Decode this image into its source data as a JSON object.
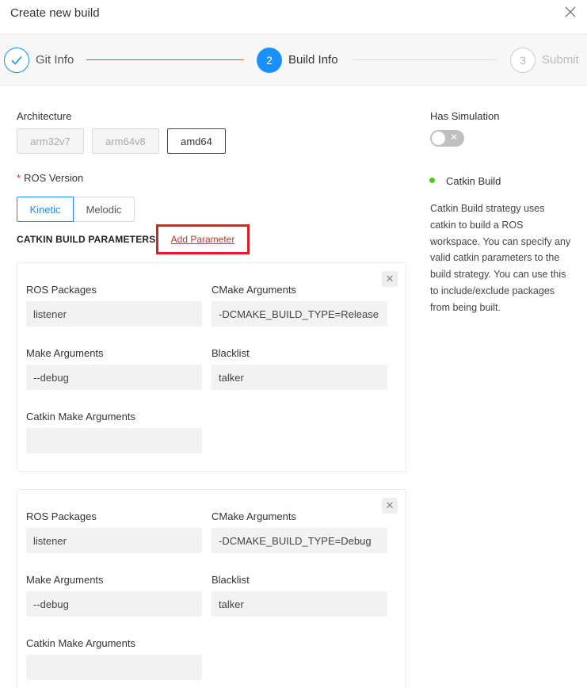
{
  "header": {
    "title": "Create new build"
  },
  "steps": [
    {
      "number": "",
      "label": "Git Info"
    },
    {
      "number": "2",
      "label": "Build Info"
    },
    {
      "number": "3",
      "label": "Submit"
    }
  ],
  "architecture": {
    "label": "Architecture",
    "options": [
      "arm32v7",
      "arm64v8",
      "amd64"
    ],
    "selected": "amd64"
  },
  "ros_version": {
    "required_mark": "*",
    "label": "ROS Version",
    "options": [
      "Kinetic",
      "Melodic"
    ],
    "selected": "Kinetic"
  },
  "catkin": {
    "section_title": "CATKIN BUILD PARAMETERS",
    "add_parameter": "Add Parameter",
    "field_labels": {
      "ros_packages": "ROS Packages",
      "cmake_arguments": "CMake Arguments",
      "make_arguments": "Make Arguments",
      "blacklist": "Blacklist",
      "catkin_make_arguments": "Catkin Make Arguments"
    },
    "parameters": [
      {
        "ros_packages": "listener",
        "cmake_arguments": "-DCMAKE_BUILD_TYPE=Release",
        "make_arguments": "--debug",
        "blacklist": "talker",
        "catkin_make_arguments": ""
      },
      {
        "ros_packages": "listener",
        "cmake_arguments": "-DCMAKE_BUILD_TYPE=Debug",
        "make_arguments": "--debug",
        "blacklist": "talker",
        "catkin_make_arguments": ""
      }
    ]
  },
  "sidebar": {
    "has_simulation_label": "Has Simulation",
    "has_simulation": false,
    "strategy_name": "Catkin Build",
    "strategy_description": "Catkin Build strategy uses catkin to build a ROS workspace. You can specify any valid catkin parameters to the build strategy. You can use this to include/exclude packages from being built."
  },
  "colors": {
    "accent": "#1890ff",
    "required": "#f5222d",
    "highlight_box": "#e02020",
    "status_dot": "#52c41a"
  },
  "icons": {
    "close": "close-icon",
    "step_done": "check-icon",
    "remove_parameter": "remove-icon",
    "toggle_off": "x-icon"
  }
}
